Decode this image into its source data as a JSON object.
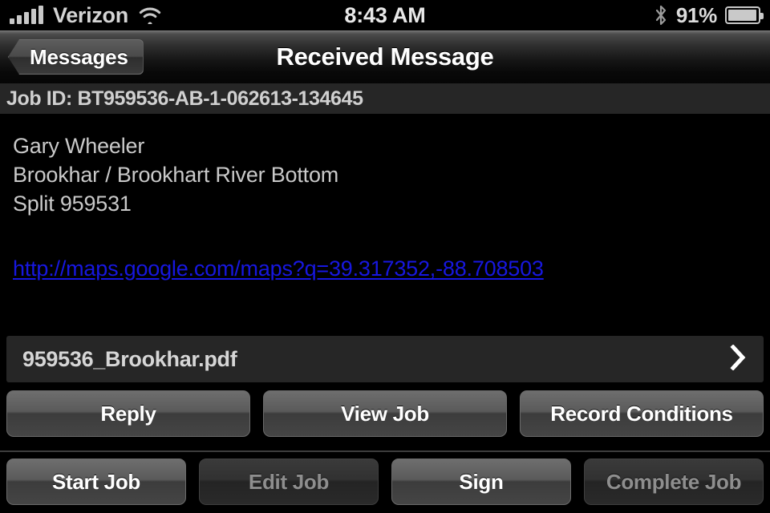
{
  "status_bar": {
    "carrier": "Verizon",
    "time": "8:43 AM",
    "battery_percent": "91%",
    "signal_bars": 5,
    "icons": [
      "signal-bars-icon",
      "wifi-icon",
      "bluetooth-icon",
      "battery-icon"
    ]
  },
  "nav_bar": {
    "back_label": "Messages",
    "title": "Received Message"
  },
  "job_id": {
    "label": "Job ID: BT959536-AB-1-062613-134645"
  },
  "message": {
    "lines": [
      "Gary Wheeler",
      "Brookhar / Brookhart River Bottom",
      "Split 959531"
    ],
    "link_text": "http://maps.google.com/maps?q=39.317352,-88.708503",
    "link_color": "#1717e0"
  },
  "attachment": {
    "filename": "959536_Brookhar.pdf"
  },
  "actions_row1": [
    {
      "label": "Reply",
      "enabled": true
    },
    {
      "label": "View Job",
      "enabled": true
    },
    {
      "label": "Record Conditions",
      "enabled": true
    }
  ],
  "actions_row2": [
    {
      "label": "Start Job",
      "enabled": true
    },
    {
      "label": "Edit Job",
      "enabled": false
    },
    {
      "label": "Sign",
      "enabled": true
    },
    {
      "label": "Complete Job",
      "enabled": false
    }
  ]
}
